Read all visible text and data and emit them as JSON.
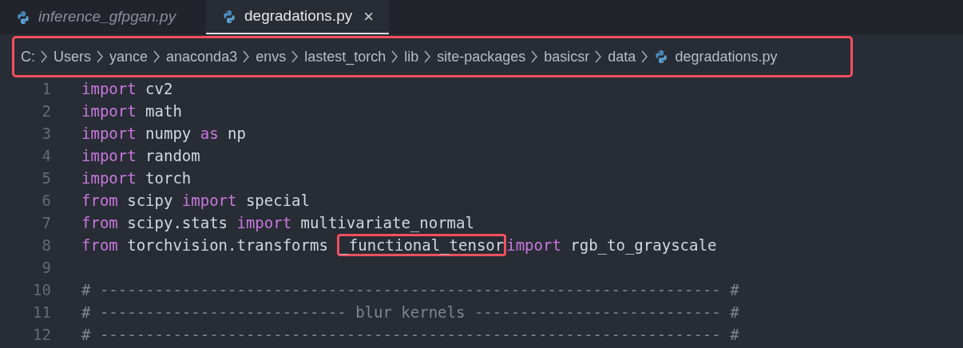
{
  "tabs": [
    {
      "label": "inference_gfpgan.py",
      "selected": false,
      "preview": true
    },
    {
      "label": "degradations.py",
      "selected": true,
      "preview": false,
      "close": "×"
    }
  ],
  "breadcrumb": {
    "highlighted": true,
    "items": [
      {
        "label": "C:",
        "kind": "folder"
      },
      {
        "label": "Users",
        "kind": "folder"
      },
      {
        "label": "yance",
        "kind": "folder"
      },
      {
        "label": "anaconda3",
        "kind": "folder"
      },
      {
        "label": "envs",
        "kind": "folder"
      },
      {
        "label": "lastest_torch",
        "kind": "folder"
      },
      {
        "label": "lib",
        "kind": "folder"
      },
      {
        "label": "site-packages",
        "kind": "folder"
      },
      {
        "label": "basicsr",
        "kind": "folder"
      },
      {
        "label": "data",
        "kind": "folder"
      },
      {
        "label": "degradations.py",
        "kind": "python"
      }
    ]
  },
  "code": [
    {
      "number": "1",
      "tokens": [
        {
          "text": "import",
          "kind": "keyword"
        },
        {
          "text": " cv2",
          "kind": "plain"
        }
      ]
    },
    {
      "number": "2",
      "tokens": [
        {
          "text": "import",
          "kind": "keyword"
        },
        {
          "text": " math",
          "kind": "plain"
        }
      ]
    },
    {
      "number": "3",
      "tokens": [
        {
          "text": "import",
          "kind": "keyword"
        },
        {
          "text": " numpy ",
          "kind": "plain"
        },
        {
          "text": "as",
          "kind": "keyword"
        },
        {
          "text": " np",
          "kind": "plain"
        }
      ]
    },
    {
      "number": "4",
      "tokens": [
        {
          "text": "import",
          "kind": "keyword"
        },
        {
          "text": " random",
          "kind": "plain"
        }
      ]
    },
    {
      "number": "5",
      "tokens": [
        {
          "text": "import",
          "kind": "keyword"
        },
        {
          "text": " torch",
          "kind": "plain"
        }
      ]
    },
    {
      "number": "6",
      "tokens": [
        {
          "text": "from",
          "kind": "keyword"
        },
        {
          "text": " scipy ",
          "kind": "plain"
        },
        {
          "text": "import",
          "kind": "keyword"
        },
        {
          "text": " special",
          "kind": "plain"
        }
      ]
    },
    {
      "number": "7",
      "tokens": [
        {
          "text": "from",
          "kind": "keyword"
        },
        {
          "text": " scipy.stats ",
          "kind": "plain"
        },
        {
          "text": "import",
          "kind": "keyword"
        },
        {
          "text": " multivariate_normal",
          "kind": "plain"
        }
      ]
    },
    {
      "number": "8",
      "tokens": [
        {
          "text": "from",
          "kind": "keyword"
        },
        {
          "text": " torchvision.transforms ",
          "kind": "plain"
        },
        {
          "text": "_functional_tensor",
          "kind": "plain",
          "highlighted": true
        },
        {
          "text": "import",
          "kind": "keyword"
        },
        {
          "text": " rgb_to_grayscale",
          "kind": "plain"
        }
      ]
    },
    {
      "number": "9"
    },
    {
      "number": "10",
      "tokens": [
        {
          "text": "# -------------------------------------------------------------------- #",
          "kind": "comment"
        }
      ]
    },
    {
      "number": "11",
      "tokens": [
        {
          "text": "# --------------------------- blur kernels --------------------------- #",
          "kind": "comment"
        }
      ]
    },
    {
      "number": "12",
      "tokens": [
        {
          "text": "# -------------------------------------------------------------------- #",
          "kind": "comment"
        }
      ]
    }
  ]
}
